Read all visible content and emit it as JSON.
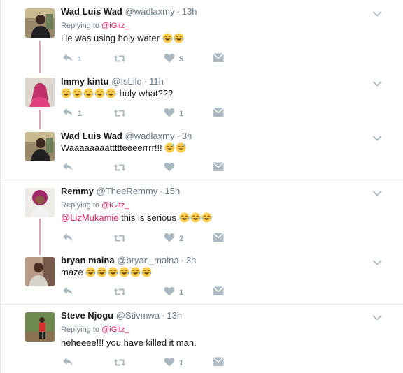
{
  "colors": {
    "accent": "#e0245e",
    "secondary": "#657786",
    "icon": "#aab8c2",
    "thread_line": "#d9a5b7"
  },
  "tweets": [
    {
      "name": "Wad Luis Wad",
      "handle": "@wadlaxmy",
      "time": "13h",
      "reply_prefix": "Replying to ",
      "reply_to": "@iGitz_",
      "text": "He was using holy water ",
      "emojis": [
        "joy",
        "joy"
      ],
      "counts": {
        "reply": "1",
        "retweet": "",
        "like": "5"
      }
    },
    {
      "name": "Immy kintu",
      "handle": "@IsLilq",
      "time": "11h",
      "text": " holy what???",
      "emojis_before": [
        "joy",
        "joy",
        "joy",
        "joy",
        "joy"
      ],
      "counts": {
        "reply": "1",
        "retweet": "",
        "like": "1"
      }
    },
    {
      "name": "Wad Luis Wad",
      "handle": "@wadlaxmy",
      "time": "3h",
      "text": "Waaaaaaaattttteeeerrrr!!! ",
      "emojis": [
        "sweat-smile",
        "sweat-smile"
      ],
      "counts": {
        "reply": "",
        "retweet": "",
        "like": ""
      }
    },
    {
      "name": "Remmy",
      "handle": "@TheeRemmy",
      "time": "15h",
      "reply_prefix": "Replying to ",
      "reply_to": "@iGitz_",
      "mention": "@LizMukamie",
      "text": " this is serious ",
      "emojis": [
        "joy",
        "joy",
        "joy"
      ],
      "counts": {
        "reply": "",
        "retweet": "",
        "like": "2"
      }
    },
    {
      "name": "bryan maina",
      "handle": "@bryan_maina",
      "time": "3h",
      "text": "maze ",
      "emojis": [
        "joy",
        "joy",
        "joy",
        "joy",
        "joy",
        "joy"
      ],
      "counts": {
        "reply": "",
        "retweet": "",
        "like": "1"
      }
    },
    {
      "name": "Steve Njogu",
      "handle": "@Stivmwa",
      "time": "13h",
      "reply_prefix": "Replying to ",
      "reply_to": "@iGitz_",
      "text": "heheeee!!! you have killed it man.",
      "counts": {
        "reply": "",
        "retweet": "",
        "like": "1"
      }
    }
  ]
}
